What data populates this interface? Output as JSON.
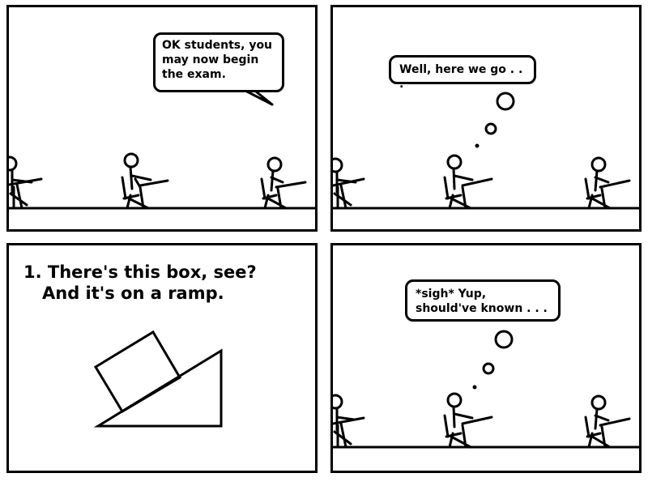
{
  "panels": [
    {
      "speech": "OK students, you\nmay now begin\nthe exam."
    },
    {
      "thought": "Well, here we go . . ."
    },
    {
      "problem": {
        "line1": "1. There's this box, see?",
        "line2": "And it's on a ramp."
      }
    },
    {
      "thought": "*sigh* Yup,\nshould've known . . ."
    }
  ]
}
